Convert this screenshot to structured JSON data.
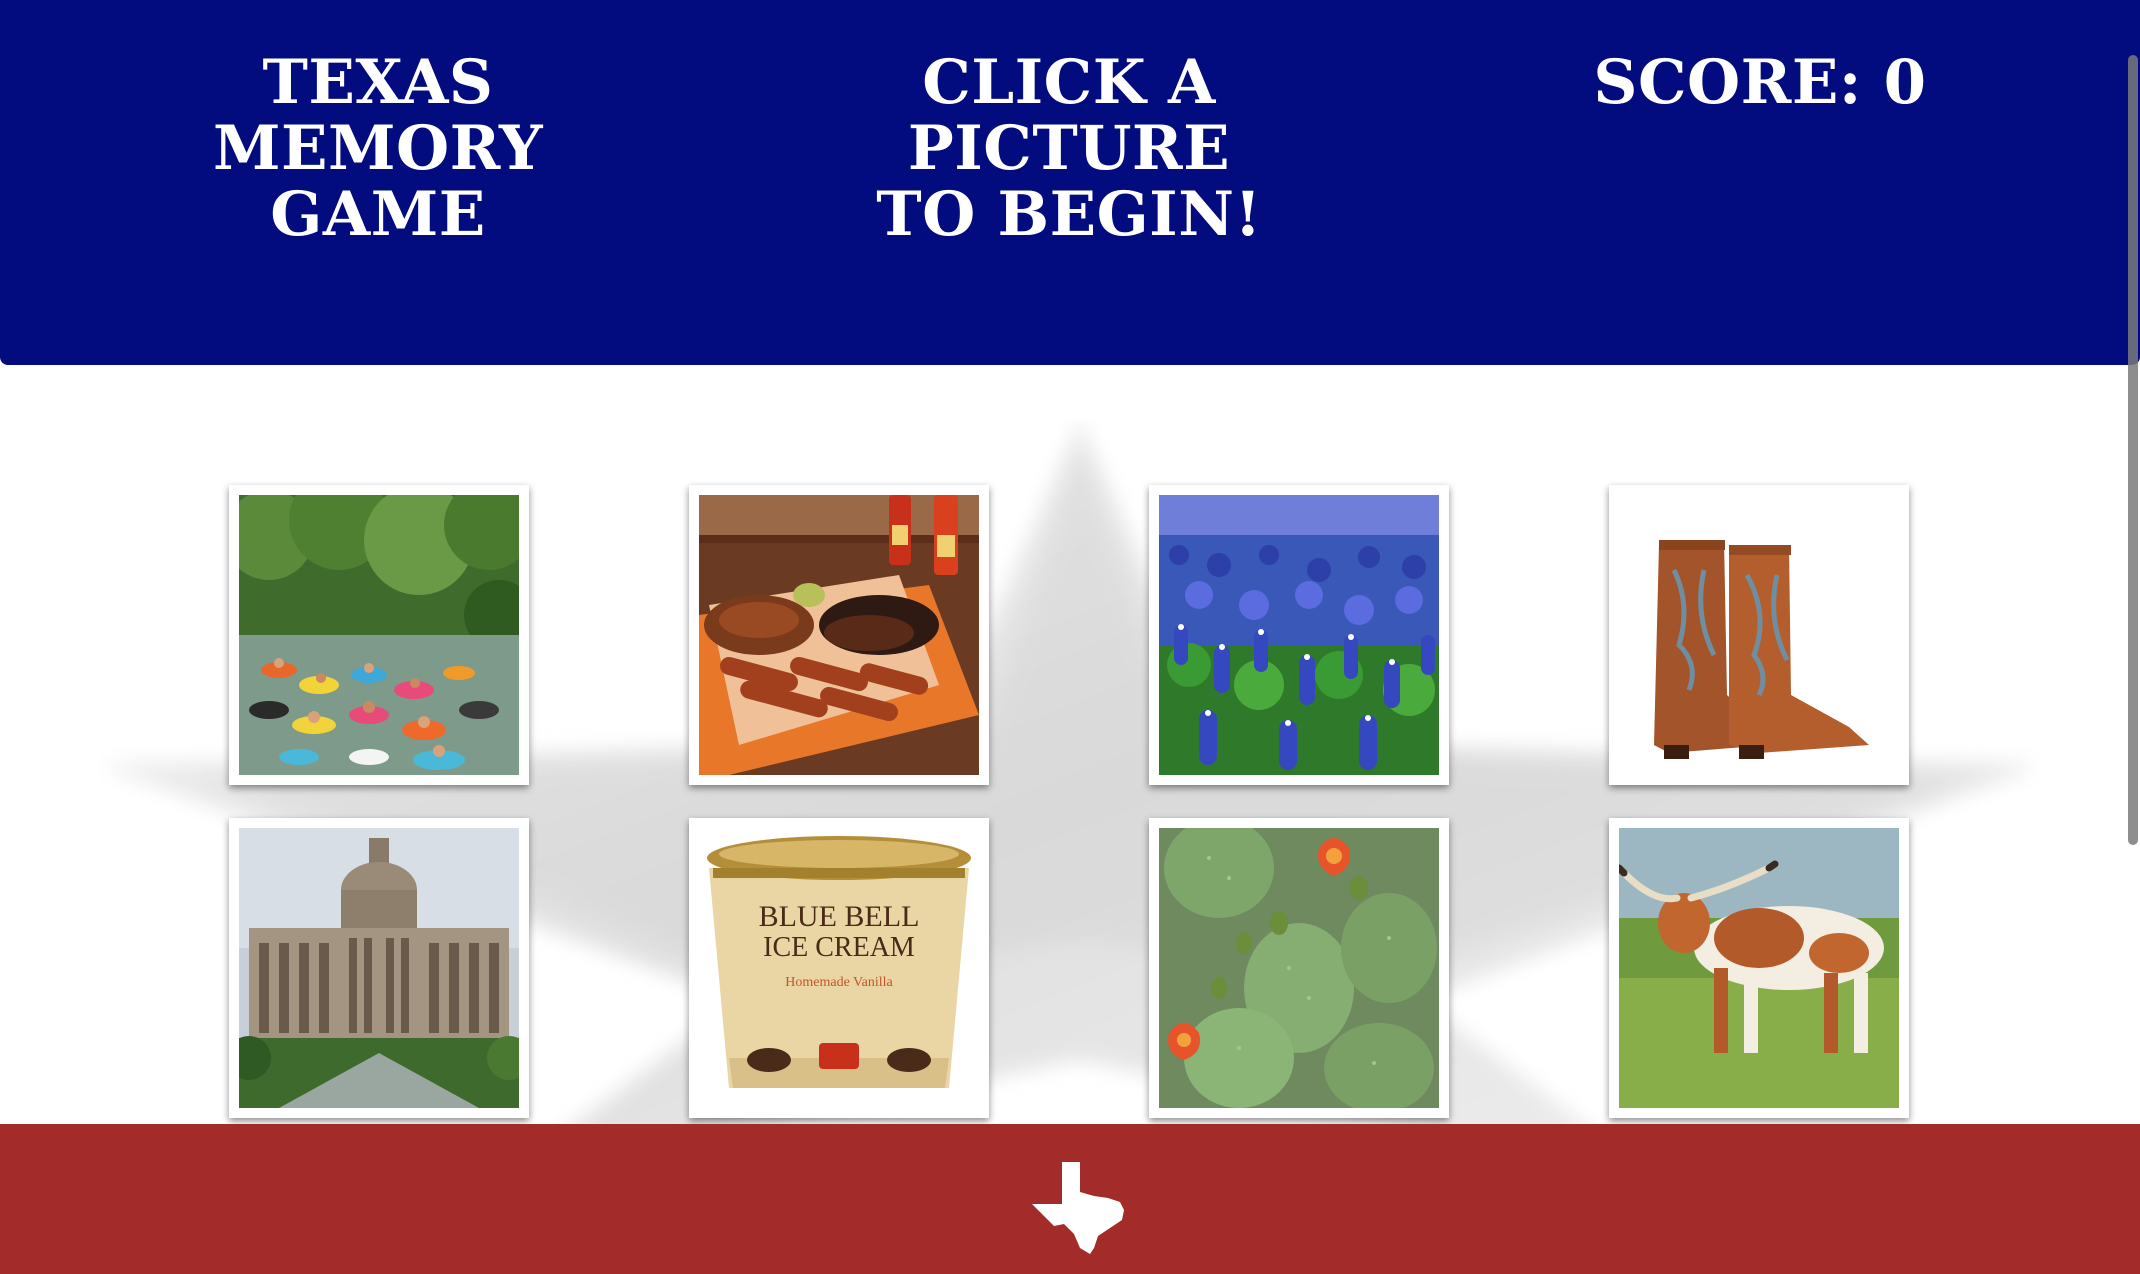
{
  "header": {
    "title_line1": "TEXAS MEMORY",
    "title_line2": "GAME",
    "message_line1": "CLICK A PICTURE",
    "message_line2": "TO BEGIN!",
    "score_label": "SCORE: 0"
  },
  "colors": {
    "header_bg": "#020c7e",
    "footer_bg": "#a32b29",
    "page_bg": "#ffffff"
  },
  "cards": [
    {
      "subject": "river-tubing"
    },
    {
      "subject": "texas-bbq-plate"
    },
    {
      "subject": "bluebonnet-field"
    },
    {
      "subject": "cowboy-boots"
    },
    {
      "subject": "texas-state-capitol"
    },
    {
      "subject": "blue-bell-ice-cream"
    },
    {
      "subject": "prickly-pear-cactus"
    },
    {
      "subject": "texas-longhorn"
    }
  ],
  "footer": {
    "icon": "texas-state-icon"
  }
}
